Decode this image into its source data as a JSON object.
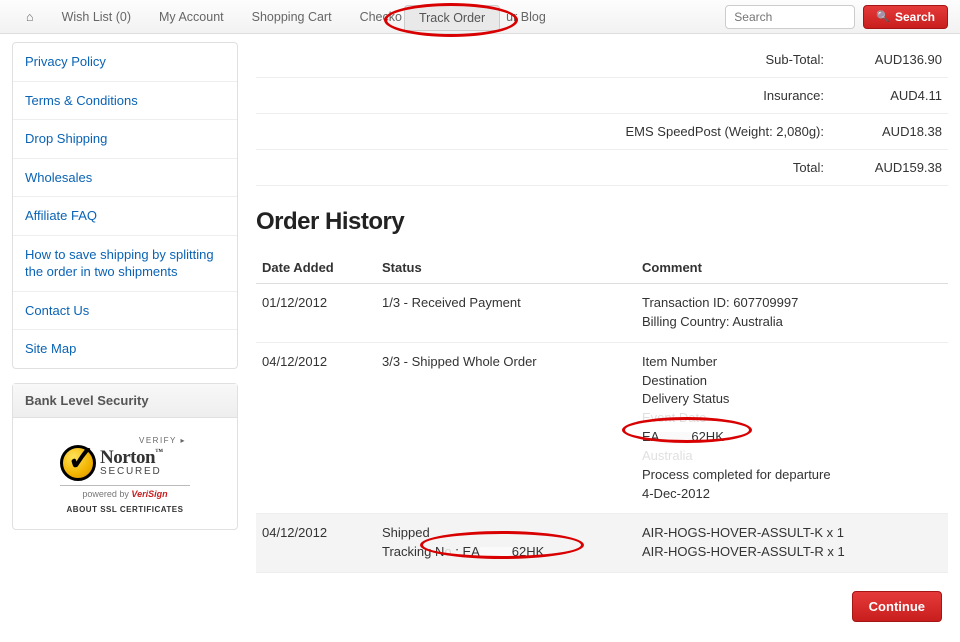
{
  "nav": {
    "wishlist": "Wish List (0)",
    "my_account": "My Account",
    "shopping_cart": "Shopping Cart",
    "checkout_partial": "Checko",
    "track_order": "Track Order",
    "blog_partial": "ur Blog"
  },
  "search": {
    "placeholder": "Search",
    "button": "Search"
  },
  "sidebar": {
    "links": [
      "Privacy Policy",
      "Terms & Conditions",
      "Drop Shipping",
      "Wholesales",
      "Affiliate FAQ",
      "How to save shipping by splitting the order in two shipments",
      "Contact Us",
      "Site Map"
    ]
  },
  "security": {
    "title": "Bank Level Security",
    "verify": "VERIFY ▸",
    "brand": "Norton",
    "secured": "SECURED",
    "powered": "powered by ",
    "verisign": "VeriSign",
    "about": "ABOUT SSL CERTIFICATES"
  },
  "totals": {
    "subtotal_label": "Sub-Total:",
    "subtotal_val": "AUD136.90",
    "insurance_label": "Insurance:",
    "insurance_val": "AUD4.11",
    "shipping_label": "EMS SpeedPost (Weight: 2,080g):",
    "shipping_val": "AUD18.38",
    "total_label": "Total:",
    "total_val": "AUD159.38"
  },
  "order_history": {
    "heading": "Order History",
    "headers": {
      "date": "Date Added",
      "status": "Status",
      "comment": "Comment"
    },
    "rows": [
      {
        "date": "01/12/2012",
        "status": "1/3 - Received Payment",
        "comment_l1": "Transaction ID: 607709997",
        "comment_l2": "Billing Country: Australia"
      },
      {
        "date": "04/12/2012",
        "status": "3/3 - Shipped Whole Order",
        "c1": "Item Number",
        "c2": "Destination",
        "c3": "Delivery Status",
        "track_a": "EA",
        "track_b": "62HK",
        "c5": "Process completed for departure",
        "c6": "4-Dec-2012"
      },
      {
        "date": "04/12/2012",
        "status_l1": "Shipped",
        "status_l2a": "Tracking N",
        "status_l2b": ".: EA",
        "status_l2c": "62HK",
        "c1": "AIR-HOGS-HOVER-ASSULT-K x 1",
        "c2": "AIR-HOGS-HOVER-ASSULT-R x 1"
      }
    ]
  },
  "continue": "Continue"
}
